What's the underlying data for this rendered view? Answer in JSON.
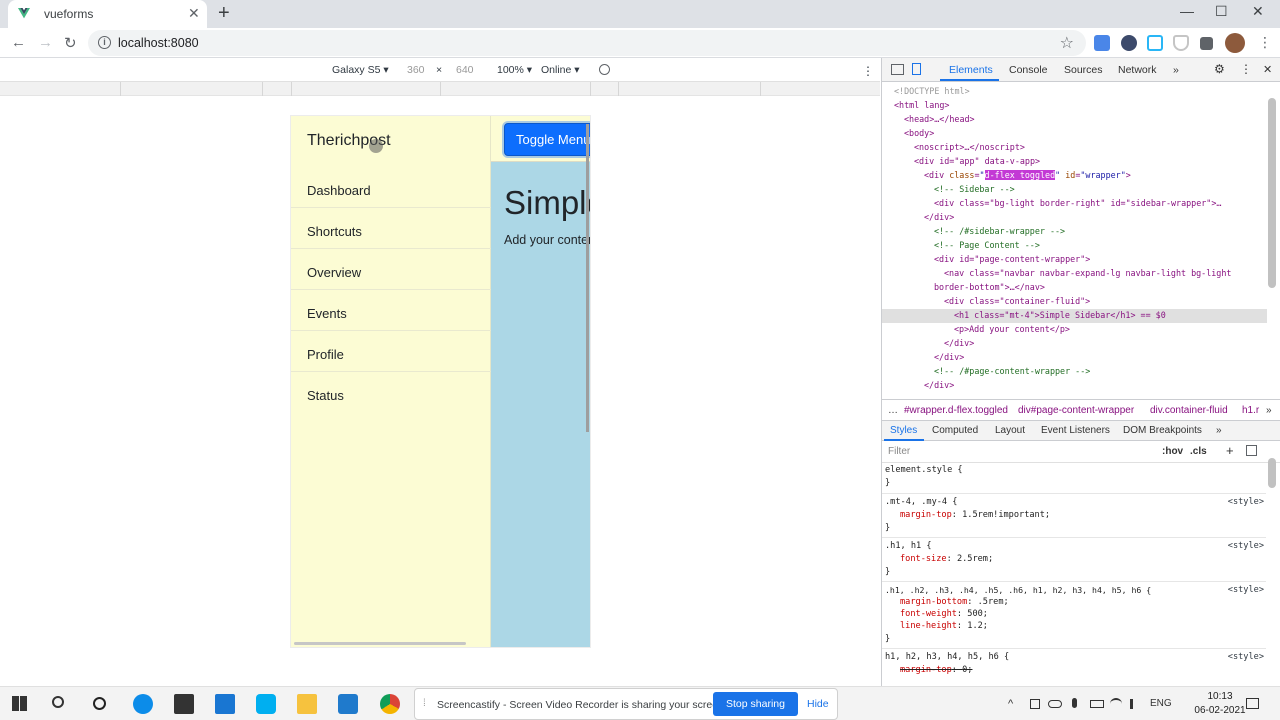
{
  "browser": {
    "tab_title": "vueforms",
    "url": "localhost:8080",
    "window_buttons": [
      "—",
      "☐",
      "✕"
    ]
  },
  "device_toolbar": {
    "device": "Galaxy S5 ▾",
    "width": "360",
    "times": "×",
    "height": "640",
    "zoom": "100% ▾",
    "network": "Online ▾"
  },
  "app": {
    "brand": "Therichpost",
    "menu": [
      "Dashboard",
      "Shortcuts",
      "Overview",
      "Events",
      "Profile",
      "Status"
    ],
    "toggle_label": "Toggle Menu",
    "heading": "Simple Sidebar",
    "paragraph": "Add your content"
  },
  "devtools": {
    "tabs": [
      "Elements",
      "Console",
      "Sources",
      "Network",
      "»"
    ],
    "dom_lines": [
      "<!DOCTYPE html>",
      "<html lang>",
      "<head>…</head>",
      "<body>",
      "<noscript>…</noscript>",
      "<div id=\"app\" data-v-app>",
      "<div class=\"d-flex toggled\" id=\"wrapper\">",
      "<!-- Sidebar -->",
      "<div class=\"bg-light border-right\" id=\"sidebar-wrapper\">…",
      "</div>",
      "<!-- /#sidebar-wrapper -->",
      "<!-- Page Content -->",
      "<div id=\"page-content-wrapper\">",
      "<nav class=\"navbar navbar-expand-lg navbar-light bg-light",
      "border-bottom\">…</nav>",
      "<div class=\"container-fluid\">",
      "<h1 class=\"mt-4\">Simple Sidebar</h1> == $0",
      "<p>Add your content</p>",
      "</div>",
      "</div>",
      "<!-- /#page-content-wrapper -->",
      "</div>"
    ],
    "breadcrumbs": [
      "…",
      "#wrapper.d-flex.toggled",
      "div#page-content-wrapper",
      "div.container-fluid",
      "h1.r",
      "»"
    ],
    "style_tabs": [
      "Styles",
      "Computed",
      "Layout",
      "Event Listeners",
      "DOM Breakpoints",
      "»"
    ],
    "filter_placeholder": "Filter",
    "filter_tools": [
      ":hov",
      ".cls",
      "+"
    ],
    "rules": [
      {
        "selector": "element.style {",
        "source": "",
        "props": []
      },
      {
        "selector": ".mt-4, .my-4 {",
        "source": "<style>",
        "props": [
          [
            "margin-top",
            "1.5rem!important;"
          ]
        ]
      },
      {
        "selector": ".h1, h1 {",
        "source": "<style>",
        "props": [
          [
            "font-size",
            "2.5rem;"
          ]
        ]
      },
      {
        "selector": ".h1, .h2, .h3, .h4, .h5, .h6, h1, h2, h3, h4, h5, h6 {",
        "source": "<style>",
        "props": [
          [
            "margin-bottom",
            ".5rem;"
          ],
          [
            "font-weight",
            "500;"
          ],
          [
            "line-height",
            "1.2;"
          ]
        ]
      },
      {
        "selector": "h1, h2, h3, h4, h5, h6 {",
        "source": "<style>",
        "props": [
          [
            "margin-top",
            "0;"
          ]
        ]
      }
    ]
  },
  "screencastify": {
    "message": "Screencastify - Screen Video Recorder is sharing your screen.",
    "stop": "Stop sharing",
    "hide": "Hide"
  },
  "taskbar": {
    "language": "ENG",
    "time": "10:13",
    "date": "06-02-2021"
  },
  "colors": {
    "sidebar_bg": "#fcfcd4",
    "content_bg": "#acd7e6",
    "toggle_btn": "#0d6efd",
    "accent": "#1a73e8"
  }
}
